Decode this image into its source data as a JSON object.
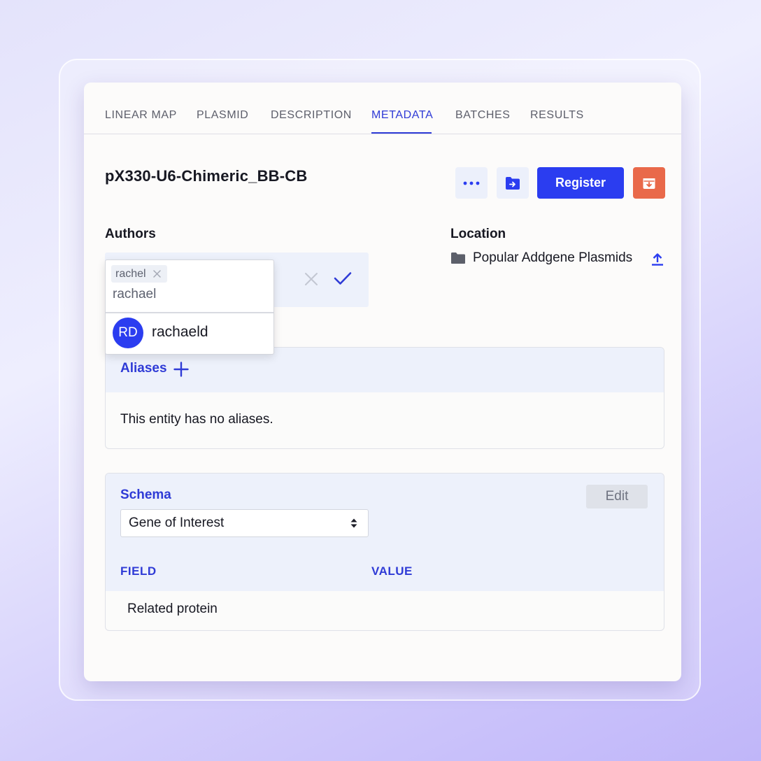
{
  "tabs": [
    {
      "label": "LINEAR MAP"
    },
    {
      "label": "PLASMID"
    },
    {
      "label": "DESCRIPTION"
    },
    {
      "label": "METADATA",
      "active": true
    },
    {
      "label": "BATCHES"
    },
    {
      "label": "RESULTS"
    }
  ],
  "entity": {
    "title": "pX330-U6-Chimeric_BB-CB"
  },
  "toolbar": {
    "more_icon": "ellipsis-icon",
    "move_icon": "folder-arrow-icon",
    "register_label": "Register",
    "archive_icon": "archive-icon"
  },
  "authors": {
    "label": "Authors",
    "chip": "rachel",
    "input_value": "rachael",
    "suggestion": {
      "initials": "RD",
      "name": "rachaeld"
    }
  },
  "location": {
    "label": "Location",
    "value": "Popular Addgene Plasmids"
  },
  "aliases": {
    "title": "Aliases",
    "empty_text": "This entity has no aliases."
  },
  "schema": {
    "title": "Schema",
    "edit_label": "Edit",
    "selected": "Gene of Interest",
    "columns": {
      "field": "FIELD",
      "value": "VALUE"
    },
    "rows": [
      {
        "field": "Related protein",
        "value": ""
      }
    ]
  },
  "colors": {
    "accent": "#2b3df0",
    "danger": "#e9694a",
    "panel_bg": "#edf1fb"
  }
}
